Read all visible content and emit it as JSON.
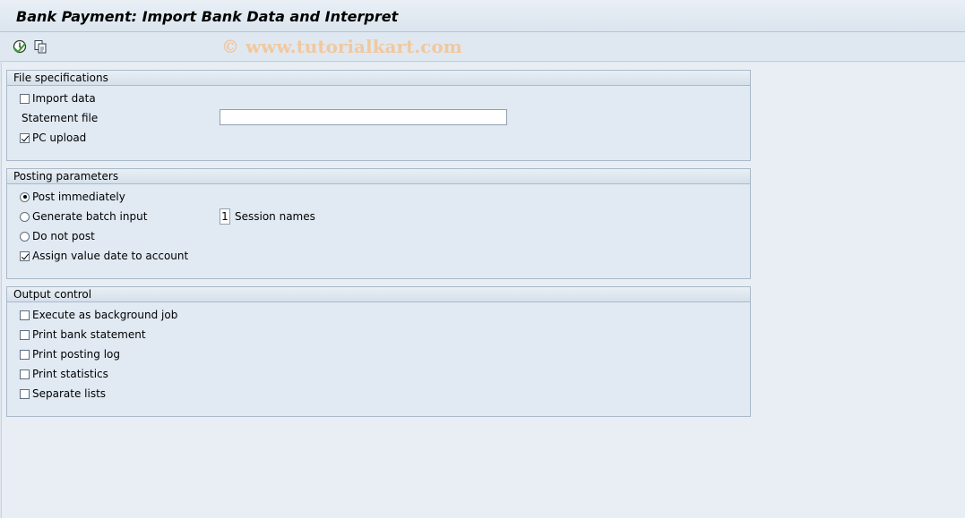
{
  "window": {
    "title": "Bank Payment: Import Bank Data and Interpret",
    "watermark": "© www.tutorialkart.com"
  },
  "toolbar": {
    "execute_icon": "execute-icon",
    "variant_icon": "get-variant-icon"
  },
  "file_specs": {
    "header": "File specifications",
    "import_data": {
      "label": "Import data",
      "checked": false
    },
    "statement_file": {
      "label": "Statement file",
      "value": ""
    },
    "pc_upload": {
      "label": "PC upload",
      "checked": true
    }
  },
  "posting": {
    "header": "Posting parameters",
    "post_immediately": {
      "label": "Post immediately",
      "selected": true
    },
    "generate_batch": {
      "label": "Generate batch input",
      "selected": false
    },
    "session_names": {
      "value": "1",
      "label": "Session names"
    },
    "do_not_post": {
      "label": "Do not post",
      "selected": false
    },
    "assign_value_date": {
      "label": "Assign value date to account",
      "checked": true
    }
  },
  "output": {
    "header": "Output control",
    "items": [
      {
        "label": "Execute as background job",
        "checked": false
      },
      {
        "label": "Print bank statement",
        "checked": false
      },
      {
        "label": "Print posting log",
        "checked": false
      },
      {
        "label": "Print statistics",
        "checked": false
      },
      {
        "label": "Separate lists",
        "checked": false
      }
    ]
  }
}
